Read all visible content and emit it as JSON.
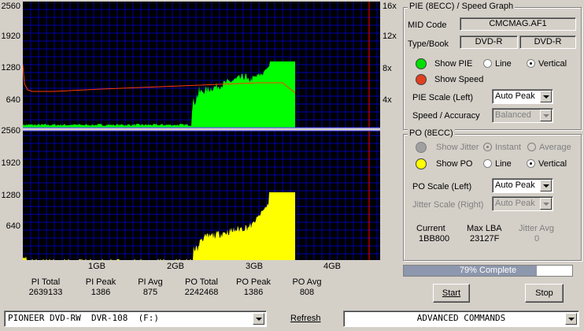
{
  "graph": {
    "top_y_ticks": [
      "2560",
      "1920",
      "1280",
      "640"
    ],
    "bottom_y_ticks": [
      "2560",
      "1920",
      "1280",
      "640"
    ],
    "speed_ticks": [
      "16x",
      "12x",
      "8x",
      "4x"
    ],
    "x_ticks": [
      "1GB",
      "2GB",
      "3GB",
      "4GB"
    ],
    "pie_color": "#00ff00",
    "po_color": "#ffff00",
    "speed_color": "#ff3c00",
    "plot_bg": "#000000",
    "grid_color": "#0000a8",
    "divider_color": "#ff0000"
  },
  "stats": [
    {
      "label": "PI Total",
      "value": "2639133"
    },
    {
      "label": "PI Peak",
      "value": "1386"
    },
    {
      "label": "PI Avg",
      "value": "875"
    },
    {
      "label": "PO Total",
      "value": "2242468"
    },
    {
      "label": "PO Peak",
      "value": "1386"
    },
    {
      "label": "PO Avg",
      "value": "808"
    }
  ],
  "pie_group": {
    "title": "PIE (8ECC) / Speed Graph",
    "mid_label": "MID Code",
    "mid_value": "CMCMAG.AF1",
    "type_label": "Type/Book",
    "type_value": "DVD-R",
    "book_value": "DVD-R",
    "show_pie": "Show PIE",
    "show_speed": "Show Speed",
    "line": "Line",
    "vertical": "Vertical",
    "scale_label": "PIE Scale (Left)",
    "scale_value": "Auto Peak",
    "accuracy_label": "Speed / Accuracy",
    "accuracy_value": "Balanced"
  },
  "po_group": {
    "title": "PO (8ECC)",
    "show_jitter": "Show Jitter",
    "instant": "Instant",
    "average": "Average",
    "show_po": "Show PO",
    "line": "Line",
    "vertical": "Vertical",
    "scale_label": "PO Scale (Left)",
    "scale_value": "Auto Peak",
    "jitter_scale_label": "Jitter Scale (Right)",
    "jitter_scale_value": "Auto Peak",
    "current_label": "Current",
    "current_value": "1BB800",
    "maxlba_label": "Max LBA",
    "maxlba_value": "23127F",
    "jitter_avg_label": "Jitter Avg",
    "jitter_avg_value": "0"
  },
  "progress": {
    "text": "79% Complete",
    "fraction": 0.79
  },
  "buttons": {
    "start": "Start",
    "stop": "Stop",
    "refresh": "Refresh"
  },
  "drive": "PIONEER DVD-RW  DVR-108  (F:)",
  "commands": "ADVANCED COMMANDS"
}
